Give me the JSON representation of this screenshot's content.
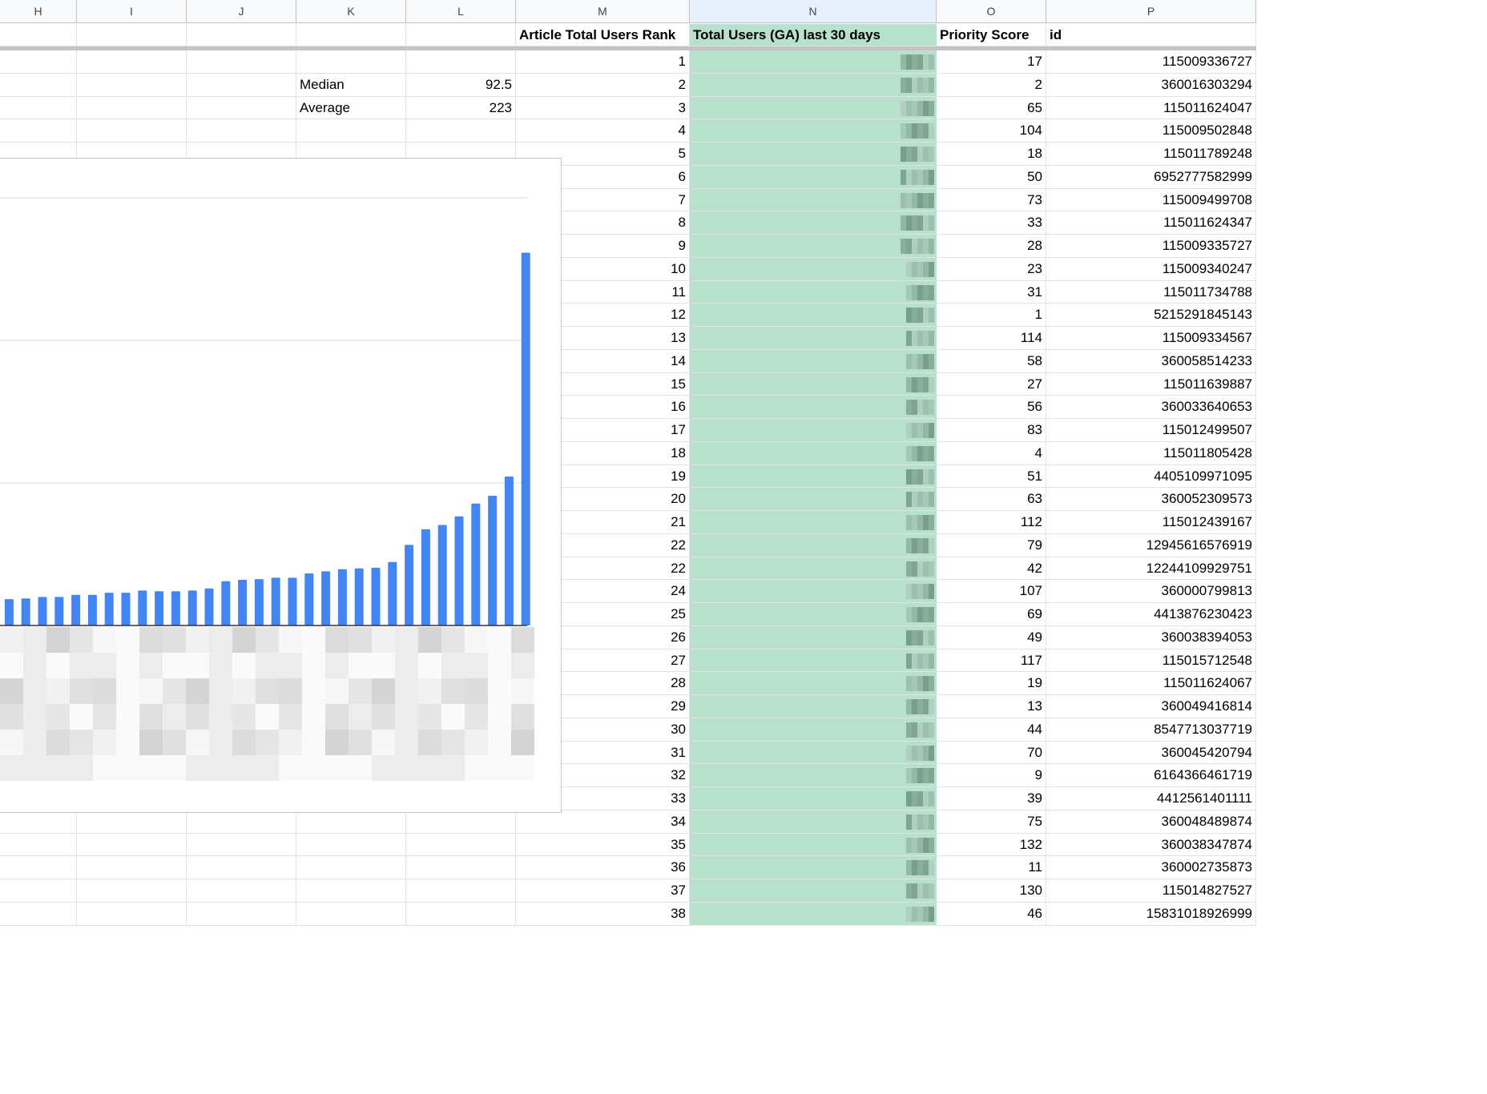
{
  "columns": [
    "H",
    "I",
    "J",
    "K",
    "L",
    "M",
    "N",
    "O",
    "P"
  ],
  "selected_column": "N",
  "header_row": {
    "rank": "Article Total Users Rank",
    "users": "Total Users (GA) last 30 days",
    "priority": "Priority Score",
    "id": "id"
  },
  "stats": {
    "median_label": "Median",
    "median_value": "92.5",
    "average_label": "Average",
    "average_value": "223"
  },
  "rows": [
    {
      "rank": "1",
      "priority": "17",
      "id": "115009336727"
    },
    {
      "rank": "2",
      "priority": "2",
      "id": "360016303294"
    },
    {
      "rank": "3",
      "priority": "65",
      "id": "115011624047"
    },
    {
      "rank": "4",
      "priority": "104",
      "id": "115009502848"
    },
    {
      "rank": "5",
      "priority": "18",
      "id": "115011789248"
    },
    {
      "rank": "6",
      "priority": "50",
      "id": "6952777582999"
    },
    {
      "rank": "7",
      "priority": "73",
      "id": "115009499708"
    },
    {
      "rank": "8",
      "priority": "33",
      "id": "115011624347"
    },
    {
      "rank": "9",
      "priority": "28",
      "id": "115009335727"
    },
    {
      "rank": "10",
      "priority": "23",
      "id": "115009340247"
    },
    {
      "rank": "11",
      "priority": "31",
      "id": "115011734788"
    },
    {
      "rank": "12",
      "priority": "1",
      "id": "5215291845143"
    },
    {
      "rank": "13",
      "priority": "114",
      "id": "115009334567"
    },
    {
      "rank": "14",
      "priority": "58",
      "id": "360058514233"
    },
    {
      "rank": "15",
      "priority": "27",
      "id": "115011639887"
    },
    {
      "rank": "16",
      "priority": "56",
      "id": "360033640653"
    },
    {
      "rank": "17",
      "priority": "83",
      "id": "115012499507"
    },
    {
      "rank": "18",
      "priority": "4",
      "id": "115011805428"
    },
    {
      "rank": "19",
      "priority": "51",
      "id": "4405109971095"
    },
    {
      "rank": "20",
      "priority": "63",
      "id": "360052309573"
    },
    {
      "rank": "21",
      "priority": "112",
      "id": "115012439167"
    },
    {
      "rank": "22",
      "priority": "79",
      "id": "12945616576919"
    },
    {
      "rank": "22",
      "priority": "42",
      "id": "12244109929751"
    },
    {
      "rank": "24",
      "priority": "107",
      "id": "360000799813"
    },
    {
      "rank": "25",
      "priority": "69",
      "id": "4413876230423"
    },
    {
      "rank": "26",
      "priority": "49",
      "id": "360038394053"
    },
    {
      "rank": "27",
      "priority": "117",
      "id": "115015712548"
    },
    {
      "rank": "28",
      "priority": "19",
      "id": "115011624067"
    },
    {
      "rank": "29",
      "priority": "13",
      "id": "360049416814"
    },
    {
      "rank": "30",
      "priority": "44",
      "id": "8547713037719"
    },
    {
      "rank": "31",
      "priority": "70",
      "id": "360045420794"
    },
    {
      "rank": "32",
      "priority": "9",
      "id": "6164366461719"
    },
    {
      "rank": "33",
      "priority": "39",
      "id": "4412561401111"
    },
    {
      "rank": "34",
      "priority": "75",
      "id": "360048489874"
    },
    {
      "rank": "35",
      "priority": "132",
      "id": "360038347874"
    },
    {
      "rank": "36",
      "priority": "11",
      "id": "360002735873"
    },
    {
      "rank": "37",
      "priority": "130",
      "id": "115014827527"
    },
    {
      "rank": "38",
      "priority": "46",
      "id": "15831018926999"
    }
  ],
  "colors": {
    "bar": "#4285f4",
    "highlight": "#b7e1cd",
    "header_bg": "#f8f9fa",
    "selected_header_bg": "#e8f0fe"
  },
  "chart_data": {
    "type": "bar",
    "x": [
      1,
      2,
      3,
      4,
      5,
      6,
      7,
      8,
      9,
      10,
      11,
      12,
      13,
      14,
      15,
      16,
      17,
      18,
      19,
      20,
      21,
      22,
      23,
      24,
      25,
      26,
      27,
      28,
      29,
      30,
      31,
      32
    ],
    "values": [
      37,
      38,
      40,
      40,
      43,
      43,
      46,
      46,
      49,
      48,
      48,
      49,
      52,
      62,
      64,
      65,
      67,
      67,
      73,
      76,
      79,
      80,
      81,
      89,
      113,
      135,
      141,
      153,
      171,
      182,
      209,
      523
    ],
    "ylim": [
      0,
      600
    ],
    "grid": true,
    "legend": "none"
  }
}
